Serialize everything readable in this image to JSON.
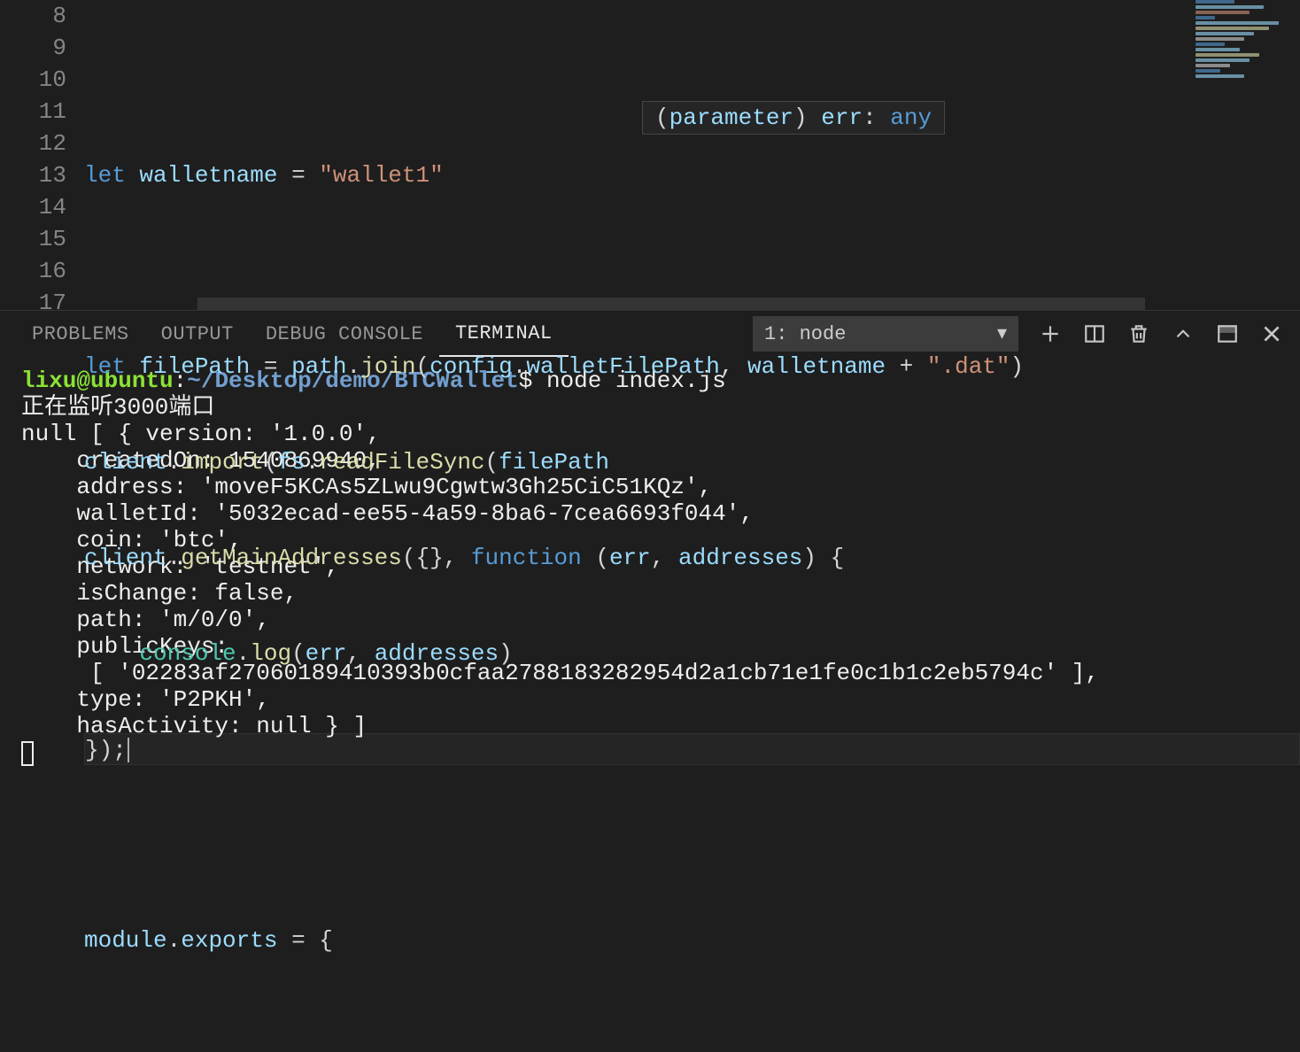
{
  "editor": {
    "lineStart": 8,
    "lines": [
      "",
      "let walletname = \"wallet1\"",
      "",
      "let filePath = path.join(config.walletFilePath, walletname + \".dat\")",
      "client.import(fs.readFileSync(filePath",
      "client.getMainAddresses({}, function (err, addresses) {",
      "    console.log(err, addresses)",
      "});",
      "",
      "module.exports = {"
    ],
    "hover": "(parameter) err: any"
  },
  "panel": {
    "tabs": {
      "problems": "PROBLEMS",
      "output": "OUTPUT",
      "debug": "DEBUG CONSOLE",
      "terminal": "TERMINAL"
    },
    "select": "1: node"
  },
  "terminal": {
    "user": "lixu@ubuntu",
    "colon": ":",
    "path": "~/Desktop/demo/BTCWallet",
    "prompt": "$",
    "cmd": "node index.js",
    "output": "正在监听3000端口\nnull [ { version: '1.0.0',\n    createdOn: 1540869940,\n    address: 'moveF5KCAs5ZLwu9Cgwtw3Gh25CiC51KQz',\n    walletId: '5032ecad-ee55-4a59-8ba6-7cea6693f044',\n    coin: 'btc',\n    network: 'testnet',\n    isChange: false,\n    path: 'm/0/0',\n    publicKeys:\n     [ '02283af27060189410393b0cfaa2788183282954d2a1cb71e1fe0c1b1c2eb5794c' ],\n    type: 'P2PKH',\n    hasActivity: null } ]"
  }
}
